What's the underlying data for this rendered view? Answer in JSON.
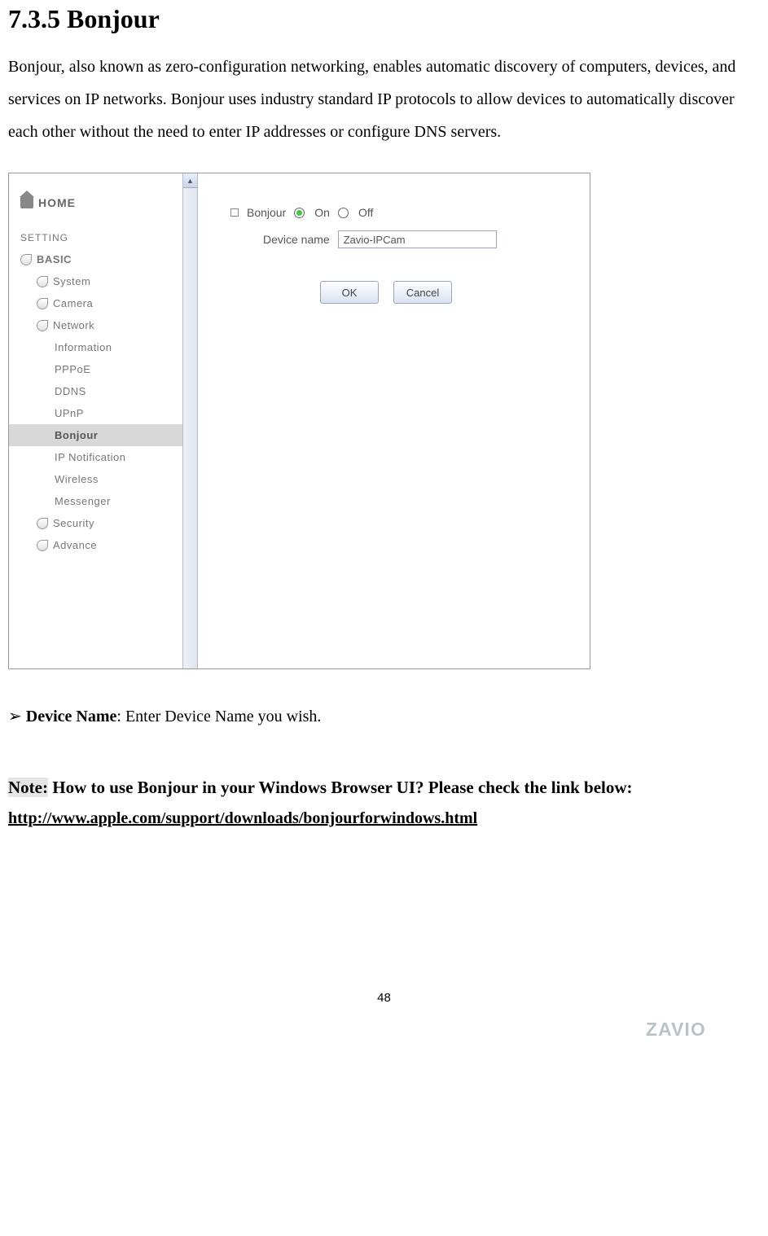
{
  "heading": "7.3.5 Bonjour",
  "body": "Bonjour, also known as zero-configuration networking, enables automatic discovery of computers, devices, and services on IP networks. Bonjour uses industry standard IP protocols to allow devices to automatically discover each other without the need to enter IP addresses or configure DNS servers.",
  "sidebar": {
    "home": "HOME",
    "setting": "SETTING",
    "basic": "BASIC",
    "system": "System",
    "camera": "Camera",
    "network": "Network",
    "information": "Information",
    "pppoe": "PPPoE",
    "ddns": "DDNS",
    "upnp": "UPnP",
    "bonjour": "Bonjour",
    "ipnotification": "IP Notification",
    "wireless": "Wireless",
    "messenger": "Messenger",
    "security": "Security",
    "advance": "Advance"
  },
  "form": {
    "bonjour_label": "Bonjour",
    "on_label": "On",
    "off_label": "Off",
    "device_name_label": "Device name",
    "device_name_value": "Zavio-IPCam",
    "ok": "OK",
    "cancel": "Cancel"
  },
  "bullet": {
    "arrow": "➢",
    "label": "Device Name",
    "text": ": Enter Device Name you wish."
  },
  "note": {
    "prefix": "Note:",
    "text": " How to use Bonjour in your Windows Browser UI? Please check the link below:"
  },
  "link": "http://www.apple.com/support/downloads/bonjourforwindows.html",
  "page_number": "48",
  "logo": "ZAVIO"
}
